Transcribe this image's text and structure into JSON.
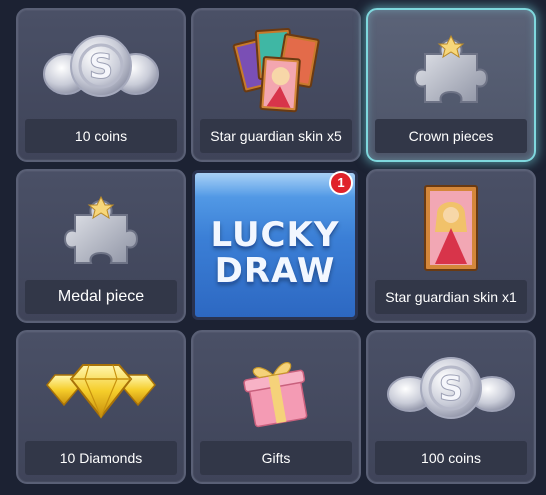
{
  "rewards": [
    {
      "label": "10 coins",
      "icon": "silver-coins-icon"
    },
    {
      "label": "Star guardian skin x5",
      "icon": "skin-cards-icon"
    },
    {
      "label": "Crown pieces",
      "icon": "puzzle-piece-icon",
      "highlighted": true
    },
    {
      "label": "Medal piece",
      "icon": "puzzle-piece-icon"
    },
    {
      "label": "Star guardian skin x1",
      "icon": "skin-card-icon"
    },
    {
      "label": "10 Diamonds",
      "icon": "gold-diamonds-icon"
    },
    {
      "label": "Gifts",
      "icon": "gift-box-icon"
    },
    {
      "label": "100 coins",
      "icon": "silver-coins-icon"
    }
  ],
  "lucky_draw": {
    "line1": "LUCKY",
    "line2": "DRAW",
    "badge_count": "1"
  },
  "colors": {
    "background": "#1c2233",
    "cell": "#454a5f",
    "highlight_border": "#7fd8de",
    "lucky_blue": "#3b7fd6",
    "badge_red": "#e0222a"
  }
}
